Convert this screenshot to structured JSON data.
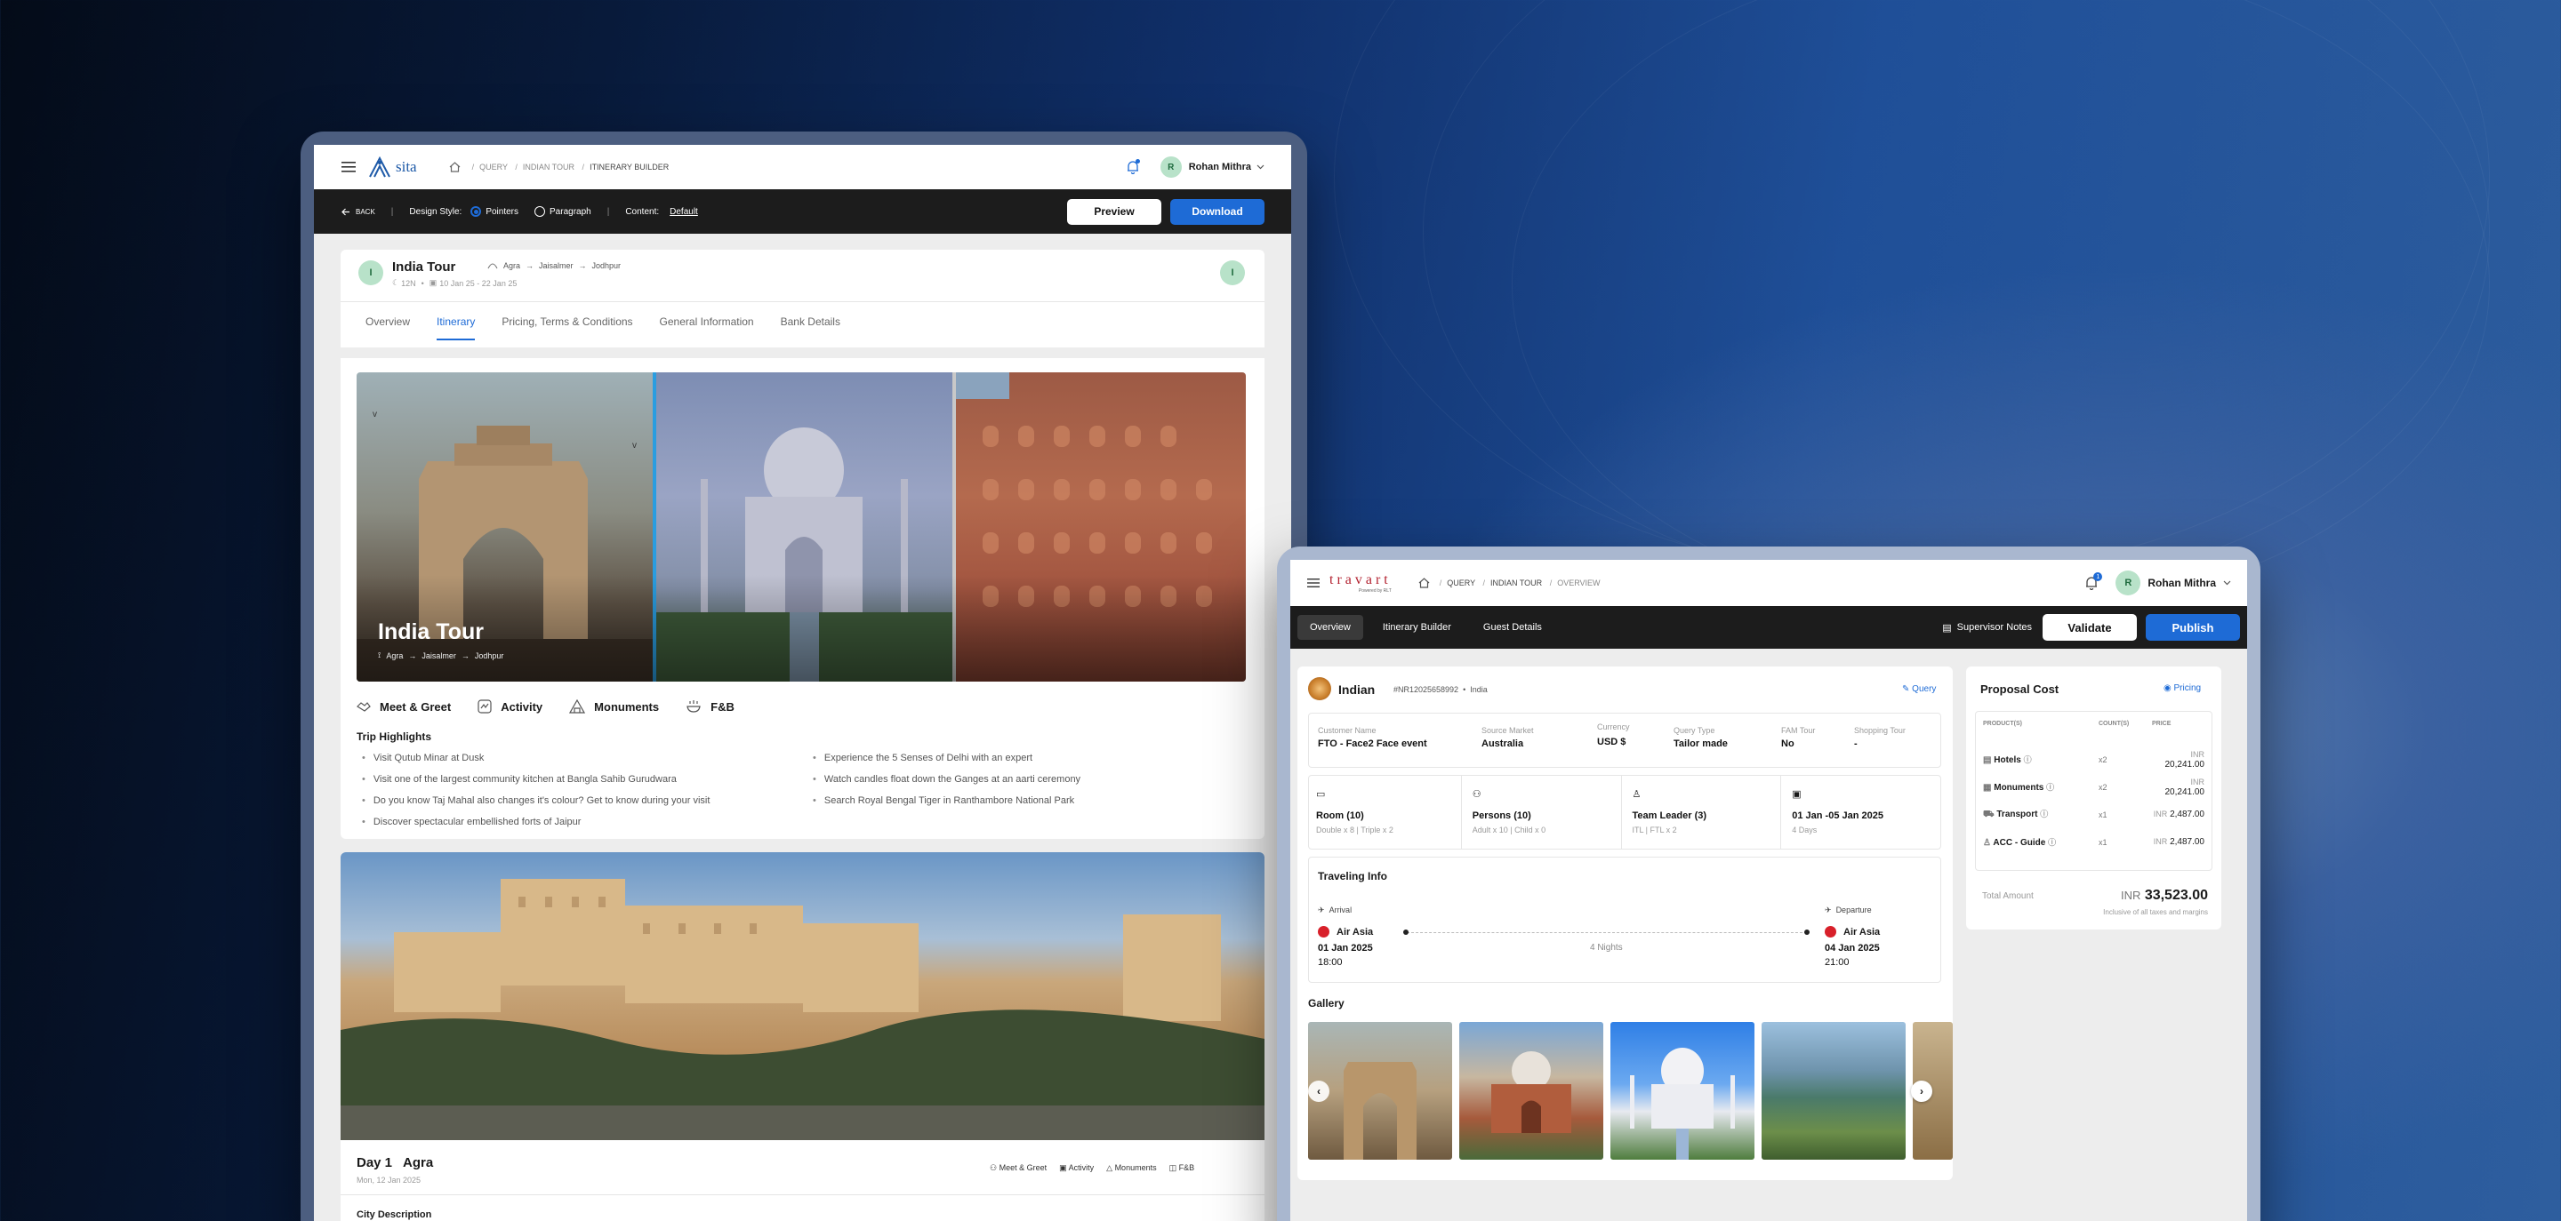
{
  "left": {
    "logo": "sita",
    "breadcrumb": [
      "QUERY",
      "INDIAN TOUR",
      "ITINERARY BUILDER"
    ],
    "user": {
      "initial": "R",
      "name": "Rohan Mithra"
    },
    "toolbar": {
      "back": "BACK",
      "design_style_label": "Design Style:",
      "opt_pointers": "Pointers",
      "opt_paragraph": "Paragraph",
      "content_label": "Content:",
      "content_value": "Default",
      "preview": "Preview",
      "download": "Download"
    },
    "trip": {
      "initial": "I",
      "title": "India Tour",
      "route": [
        "Agra",
        "Jaisalmer",
        "Jodhpur"
      ],
      "nights": "12N",
      "dates": "10 Jan 25 - 22 Jan 25",
      "right_initial": "I"
    },
    "tabs": [
      "Overview",
      "Itinerary",
      "Pricing, Terms & Conditions",
      "General Information",
      "Bank Details"
    ],
    "active_tab": 1,
    "hero": {
      "title": "India Tour",
      "route": [
        "Agra",
        "Jaisalmer",
        "Jodhpur"
      ]
    },
    "features": [
      "Meet & Greet",
      "Activity",
      "Monuments",
      "F&B"
    ],
    "highlights_title": "Trip Highlights",
    "highlights_left": [
      "Visit Qutub Minar at Dusk",
      "Visit one of the largest community kitchen at Bangla Sahib Gurudwara",
      "Do you know Taj Mahal also changes it's colour? Get to know during your visit",
      "Discover spectacular embellished forts of Jaipur"
    ],
    "highlights_right": [
      "Experience the 5 Senses of Delhi with an expert",
      "Watch candles float down the Ganges at an aarti ceremony",
      "Search Royal Bengal Tiger in Ranthambore National Park"
    ],
    "day": {
      "label": "Day 1",
      "city": "Agra",
      "date": "Mon, 12 Jan 2025",
      "features": [
        "Meet & Greet",
        "Activity",
        "Monuments",
        "F&B"
      ],
      "city_desc": "City Description"
    }
  },
  "right": {
    "logo": "travart",
    "logo_sub": "Powered by RLT",
    "breadcrumb": [
      "QUERY",
      "INDIAN TOUR",
      "OVERVIEW"
    ],
    "notif_count": "1",
    "user": {
      "initial": "R",
      "name": "Rohan Mithra"
    },
    "tabs": [
      "Overview",
      "Itinerary Builder",
      "Guest Details"
    ],
    "supervisor": "Supervisor Notes",
    "validate": "Validate",
    "publish": "Publish",
    "query": {
      "name": "Indian",
      "id": "#NR12025658992",
      "country": "India",
      "link": "Query"
    },
    "fields": [
      {
        "label": "Customer Name",
        "value": "FTO - Face2 Face event"
      },
      {
        "label": "Source Market",
        "value": "Australia"
      },
      {
        "label": "Currency",
        "value": "USD $"
      },
      {
        "label": "Query Type",
        "value": "Tailor made"
      },
      {
        "label": "FAM Tour",
        "value": "No"
      },
      {
        "label": "Shopping Tour",
        "value": "-"
      }
    ],
    "stats": [
      {
        "title": "Room (10)",
        "sub": "Double x 8 | Triple x 2"
      },
      {
        "title": "Persons (10)",
        "sub": "Adult x 10 | Child x 0"
      },
      {
        "title": "Team Leader (3)",
        "sub": "ITL | FTL x 2"
      },
      {
        "title": "01 Jan -05 Jan 2025",
        "sub": "4 Days"
      }
    ],
    "traveling": {
      "title": "Traveling Info",
      "arrival": {
        "label": "Arrival",
        "airline": "Air Asia",
        "date": "01 Jan 2025",
        "time": "18:00"
      },
      "nights": "4 Nights",
      "departure": {
        "label": "Departure",
        "airline": "Air Asia",
        "date": "04 Jan 2025",
        "time": "21:00"
      }
    },
    "gallery_title": "Gallery",
    "proposal": {
      "title": "Proposal Cost",
      "pricing": "Pricing",
      "headers": [
        "PRODUCT(S)",
        "COUNT(S)",
        "PRICE"
      ],
      "rows": [
        {
          "name": "Hotels",
          "count": "x2",
          "cur": "INR",
          "price": "20,241.00"
        },
        {
          "name": "Monuments",
          "count": "x2",
          "cur": "INR",
          "price": "20,241.00"
        },
        {
          "name": "Transport",
          "count": "x1",
          "cur": "INR",
          "price": "2,487.00"
        },
        {
          "name": "ACC - Guide",
          "count": "x1",
          "cur": "INR",
          "price": "2,487.00"
        }
      ],
      "total_label": "Total Amount",
      "total_cur": "INR",
      "total": "33,523.00",
      "note": "Inclusive of all taxes and margins"
    }
  },
  "colors": {
    "accent": "#1e6bd6",
    "dark_bar": "#1c1c1c"
  }
}
